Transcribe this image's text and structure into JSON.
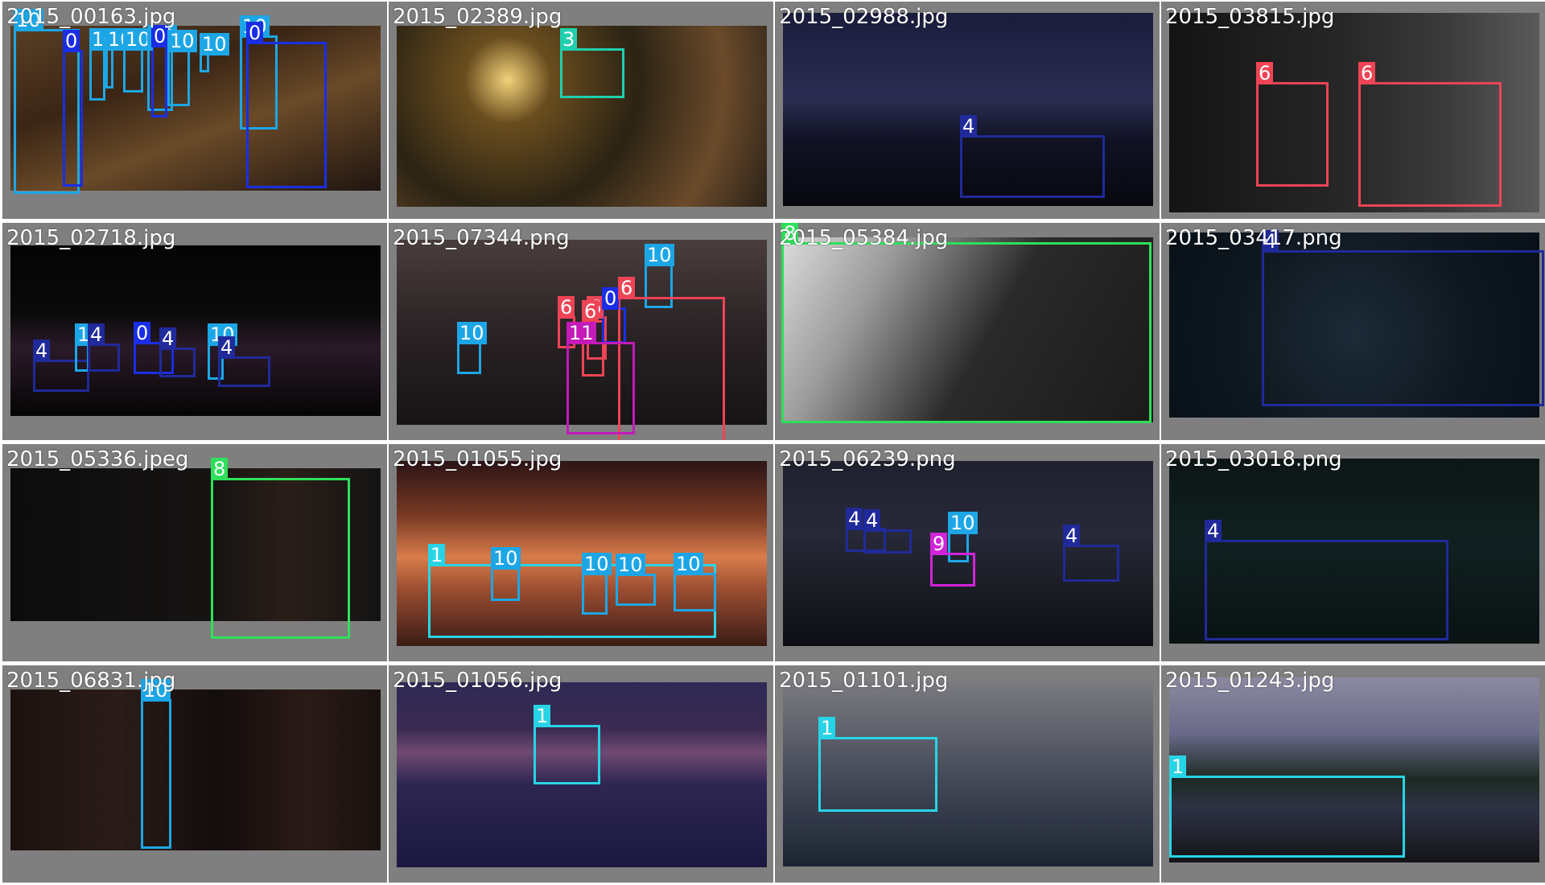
{
  "colors": {
    "0": "#1a2ee6",
    "1": "#27d4e6",
    "3": "#20cfae",
    "4": "#202a9a",
    "6": "#ee4455",
    "8": "#2ee05a",
    "9": "#d024d8",
    "10": "#1da6e6",
    "11": "#c41ab8"
  },
  "tiles": [
    {
      "name": "2015_00163.jpg",
      "bg": "linear-gradient(160deg,#5a3f24 0%,#3a2515 35%,#6a4a28 60%,#201510 100%)",
      "dets": [
        {
          "c": "10",
          "label": "10"
        },
        {
          "c": "0",
          "label": "0"
        },
        {
          "c": "10",
          "label": "10"
        },
        {
          "c": "10",
          "label": "10"
        },
        {
          "c": "10",
          "label": "10"
        },
        {
          "c": "10",
          "label": "10"
        },
        {
          "c": "0",
          "label": "0"
        },
        {
          "c": "10",
          "label": "10"
        },
        {
          "c": "10",
          "label": "10"
        },
        {
          "c": "10",
          "label": "10"
        },
        {
          "c": "0",
          "label": "0"
        }
      ]
    },
    {
      "name": "2015_02389.jpg",
      "bg": "radial-gradient(circle at 30% 30%,#f1d27a 0%,#6a4d1e 15%,#2b2314 45%,#6b4a2a 75%,#2a2218 100%)",
      "dets": [
        {
          "c": "3",
          "label": "3"
        }
      ]
    },
    {
      "name": "2015_02988.jpg",
      "bg": "linear-gradient(180deg,#1b1d3d 0%,#2a2d52 45%,#111325 65%,#07070e 100%)",
      "dets": [
        {
          "c": "4",
          "label": "4"
        }
      ]
    },
    {
      "name": "2015_03815.jpg",
      "bg": "linear-gradient(90deg,#141414 0%,#262626 45%,#3b3b3b 75%,#5a5a5a 100%)",
      "dets": [
        {
          "c": "6",
          "label": "6"
        },
        {
          "c": "6",
          "label": "6"
        }
      ]
    },
    {
      "name": "2015_02718.jpg",
      "bg": "linear-gradient(180deg,#040404 0%,#0a0a0a 40%,#2a1a28 60%,#050505 100%)",
      "dets": [
        {
          "c": "4",
          "label": "4"
        },
        {
          "c": "10",
          "label": "10"
        },
        {
          "c": "4",
          "label": "4"
        },
        {
          "c": "0",
          "label": "0"
        },
        {
          "c": "4",
          "label": "4"
        },
        {
          "c": "10",
          "label": "10"
        },
        {
          "c": "4",
          "label": "4"
        }
      ]
    },
    {
      "name": "2015_07344.png",
      "bg": "linear-gradient(180deg,#4a3d3d 0%,#2a2224 50%,#161414 100%)",
      "dets": [
        {
          "c": "10",
          "label": "10"
        },
        {
          "c": "10",
          "label": "10"
        },
        {
          "c": "6",
          "label": "6"
        },
        {
          "c": "6",
          "label": "6"
        },
        {
          "c": "6",
          "label": "6"
        },
        {
          "c": "0",
          "label": "0"
        },
        {
          "c": "6",
          "label": "6"
        },
        {
          "c": "11",
          "label": "11"
        }
      ]
    },
    {
      "name": "2015_05384.jpg",
      "bg": "linear-gradient(120deg,#dcdcdc 0%,#9a9a9a 25%,#2a2a2a 55%,#1a1a1a 100%)",
      "dets": [
        {
          "c": "8",
          "label": "8"
        }
      ]
    },
    {
      "name": "2015_03417.png",
      "bg": "radial-gradient(circle at 50% 55%,#1c2b38 0%,#0f1820 55%,#081018 100%)",
      "dets": [
        {
          "c": "4",
          "label": "4"
        }
      ]
    },
    {
      "name": "2015_05336.jpeg",
      "bg": "linear-gradient(90deg,#0c0c0c 0%,#161413 55%,#2a1e18 75%,#141414 100%)",
      "dets": [
        {
          "c": "8",
          "label": "8"
        }
      ]
    },
    {
      "name": "2015_01055.jpg",
      "bg": "linear-gradient(180deg,#2b1416 0%,#7a3a24 30%,#d97c4a 52%,#9a4c30 70%,#3a1c16 100%)",
      "dets": [
        {
          "c": "1",
          "label": "1"
        },
        {
          "c": "10",
          "label": "10"
        },
        {
          "c": "10",
          "label": "10"
        },
        {
          "c": "10",
          "label": "10"
        },
        {
          "c": "10",
          "label": "10"
        }
      ]
    },
    {
      "name": "2015_06239.png",
      "bg": "linear-gradient(180deg,#1f2130 0%,#272838 40%,#1a1c24 70%,#0d0e13 100%)",
      "dets": [
        {
          "c": "4",
          "label": "4"
        },
        {
          "c": "4",
          "label": "4"
        },
        {
          "c": "10",
          "label": "10"
        },
        {
          "c": "9",
          "label": "9"
        },
        {
          "c": "4",
          "label": "4"
        }
      ]
    },
    {
      "name": "2015_03018.png",
      "bg": "linear-gradient(180deg,#0d1616 0%,#102020 45%,#0a1214 100%)",
      "dets": [
        {
          "c": "4",
          "label": "4"
        }
      ]
    },
    {
      "name": "2015_06831.jpg",
      "bg": "linear-gradient(90deg,#1d1210 0%,#2a1c18 30%,#130d0c 55%,#2a1a16 80%,#1a1210 100%)",
      "dets": [
        {
          "c": "10",
          "label": "10"
        }
      ]
    },
    {
      "name": "2015_01056.jpg",
      "bg": "linear-gradient(180deg,#2e2a55 0%,#3a2a52 25%,#6f4a72 38%,#2d2652 55%,#1a1840 100%)",
      "dets": [
        {
          "c": "1",
          "label": "1"
        }
      ]
    },
    {
      "name": "2015_01101.jpg",
      "bg": "linear-gradient(180deg,#7a7a80 0%,#5c5f6a 30%,#3c4352 60%,#1d2534 100%)",
      "dets": [
        {
          "c": "1",
          "label": "1"
        }
      ]
    },
    {
      "name": "2015_01243.jpg",
      "bg": "linear-gradient(180deg,#8c8aa0 0%,#6a6a8a 30%,#1d2a22 55%,#2e3245 70%,#141418 100%)",
      "dets": [
        {
          "c": "1",
          "label": "1"
        }
      ]
    }
  ]
}
